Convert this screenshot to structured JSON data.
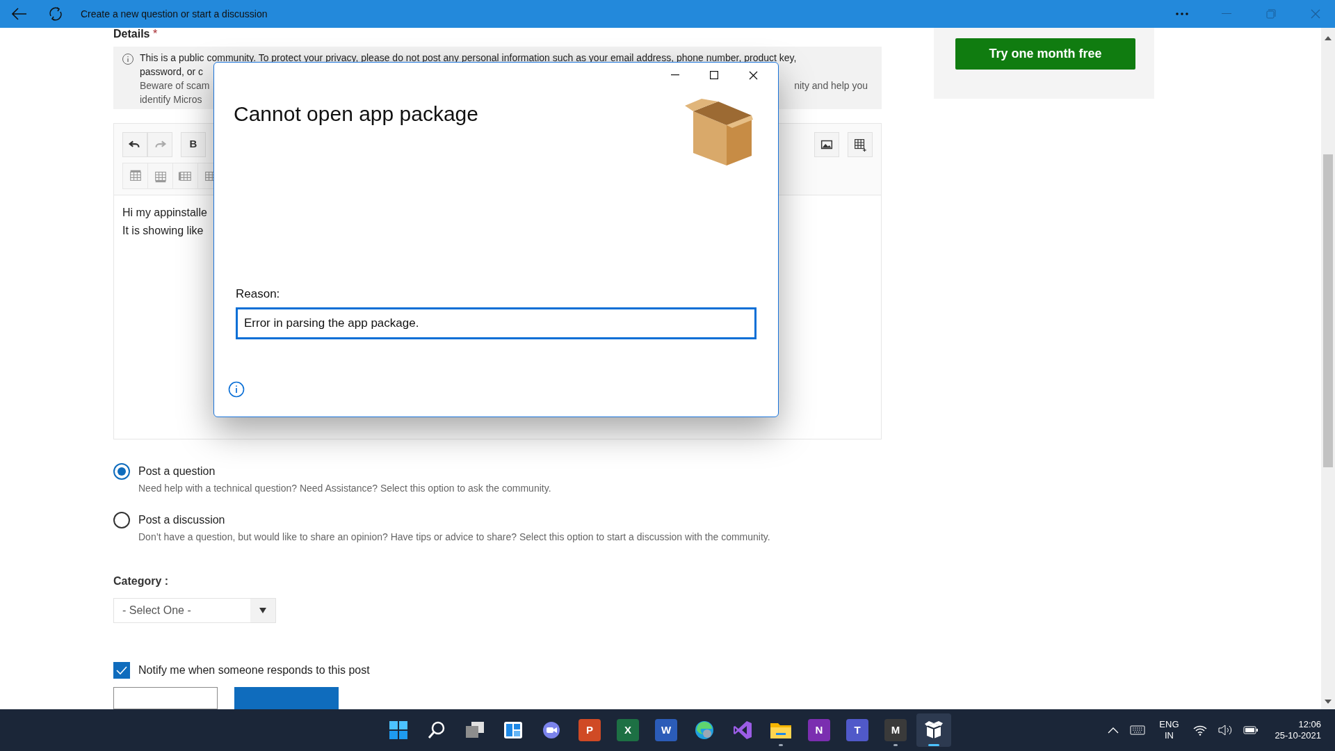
{
  "window": {
    "title": "Create a new question or start a discussion"
  },
  "details": {
    "label": "Details",
    "required_mark": "*",
    "notice": [
      {
        "left": "This is a public community. To protect your privacy, please do not post any personal information such as your email address, phone number, product key,",
        "strong": true
      },
      {
        "left": "password, or c",
        "strong": true
      },
      {
        "left": "Beware of scam",
        "right": "nity and help you",
        "strong": false
      },
      {
        "left": "identify Micros",
        "strong": false
      }
    ]
  },
  "editor": {
    "toolbar_left": [
      {
        "kind": "undo",
        "disabled": false
      },
      {
        "kind": "redo",
        "disabled": true
      },
      {
        "kind": "bold",
        "glyph": "B",
        "disabled": false
      }
    ],
    "toolbar_right": [
      {
        "kind": "image",
        "disabled": false
      },
      {
        "kind": "table",
        "disabled": false
      }
    ],
    "table_tools": [
      {
        "kind": "row-above"
      },
      {
        "kind": "row-below"
      },
      {
        "kind": "col-left"
      },
      {
        "kind": "col-right"
      }
    ],
    "lines": [
      "Hi my appinstalle",
      "It is showing like"
    ]
  },
  "post_types": [
    {
      "label": "Post a question",
      "description": "Need help with a technical question? Need Assistance? Select this option to ask the community.",
      "selected": true
    },
    {
      "label": "Post a discussion",
      "description": "Don’t have a question, but would like to share an opinion? Have tips or advice to share? Select this option to start a discussion with the community.",
      "selected": false
    }
  ],
  "category": {
    "label": "Category :",
    "value": "- Select One -"
  },
  "notify": {
    "label": "Notify me when someone responds to this post",
    "checked": true
  },
  "promo": {
    "button": "Try one month free"
  },
  "dialog": {
    "title": "Cannot open app package",
    "reason_label": "Reason:",
    "reason": "Error in parsing the app package."
  },
  "taskbar": {
    "apps": [
      {
        "kind": "start",
        "running": false,
        "active": false
      },
      {
        "kind": "search",
        "running": false,
        "active": false
      },
      {
        "kind": "taskview",
        "running": false,
        "active": false
      },
      {
        "kind": "widgets",
        "running": false,
        "active": false
      },
      {
        "kind": "chat",
        "running": false,
        "active": false
      },
      {
        "kind": "tile",
        "glyph": "P",
        "color": "#d04a25",
        "running": false,
        "active": false
      },
      {
        "kind": "tile",
        "glyph": "X",
        "color": "#1d7044",
        "running": false,
        "active": false
      },
      {
        "kind": "tile",
        "glyph": "W",
        "color": "#2b5cb8",
        "running": false,
        "active": false
      },
      {
        "kind": "edge",
        "running": false,
        "active": false
      },
      {
        "kind": "vs",
        "running": false,
        "active": false
      },
      {
        "kind": "folder",
        "running": true,
        "active": false
      },
      {
        "kind": "tile",
        "glyph": "N",
        "color": "#7b2eb0",
        "running": false,
        "active": false
      },
      {
        "kind": "tile",
        "glyph": "T",
        "color": "#5059c9",
        "running": false,
        "active": false
      },
      {
        "kind": "tile",
        "glyph": "M",
        "color": "#3a3a3a",
        "running": true,
        "active": false
      },
      {
        "kind": "package",
        "running": true,
        "active": true
      }
    ],
    "lang": "ENG",
    "region": "IN",
    "time": "12:06",
    "date": "25-10-2021"
  }
}
